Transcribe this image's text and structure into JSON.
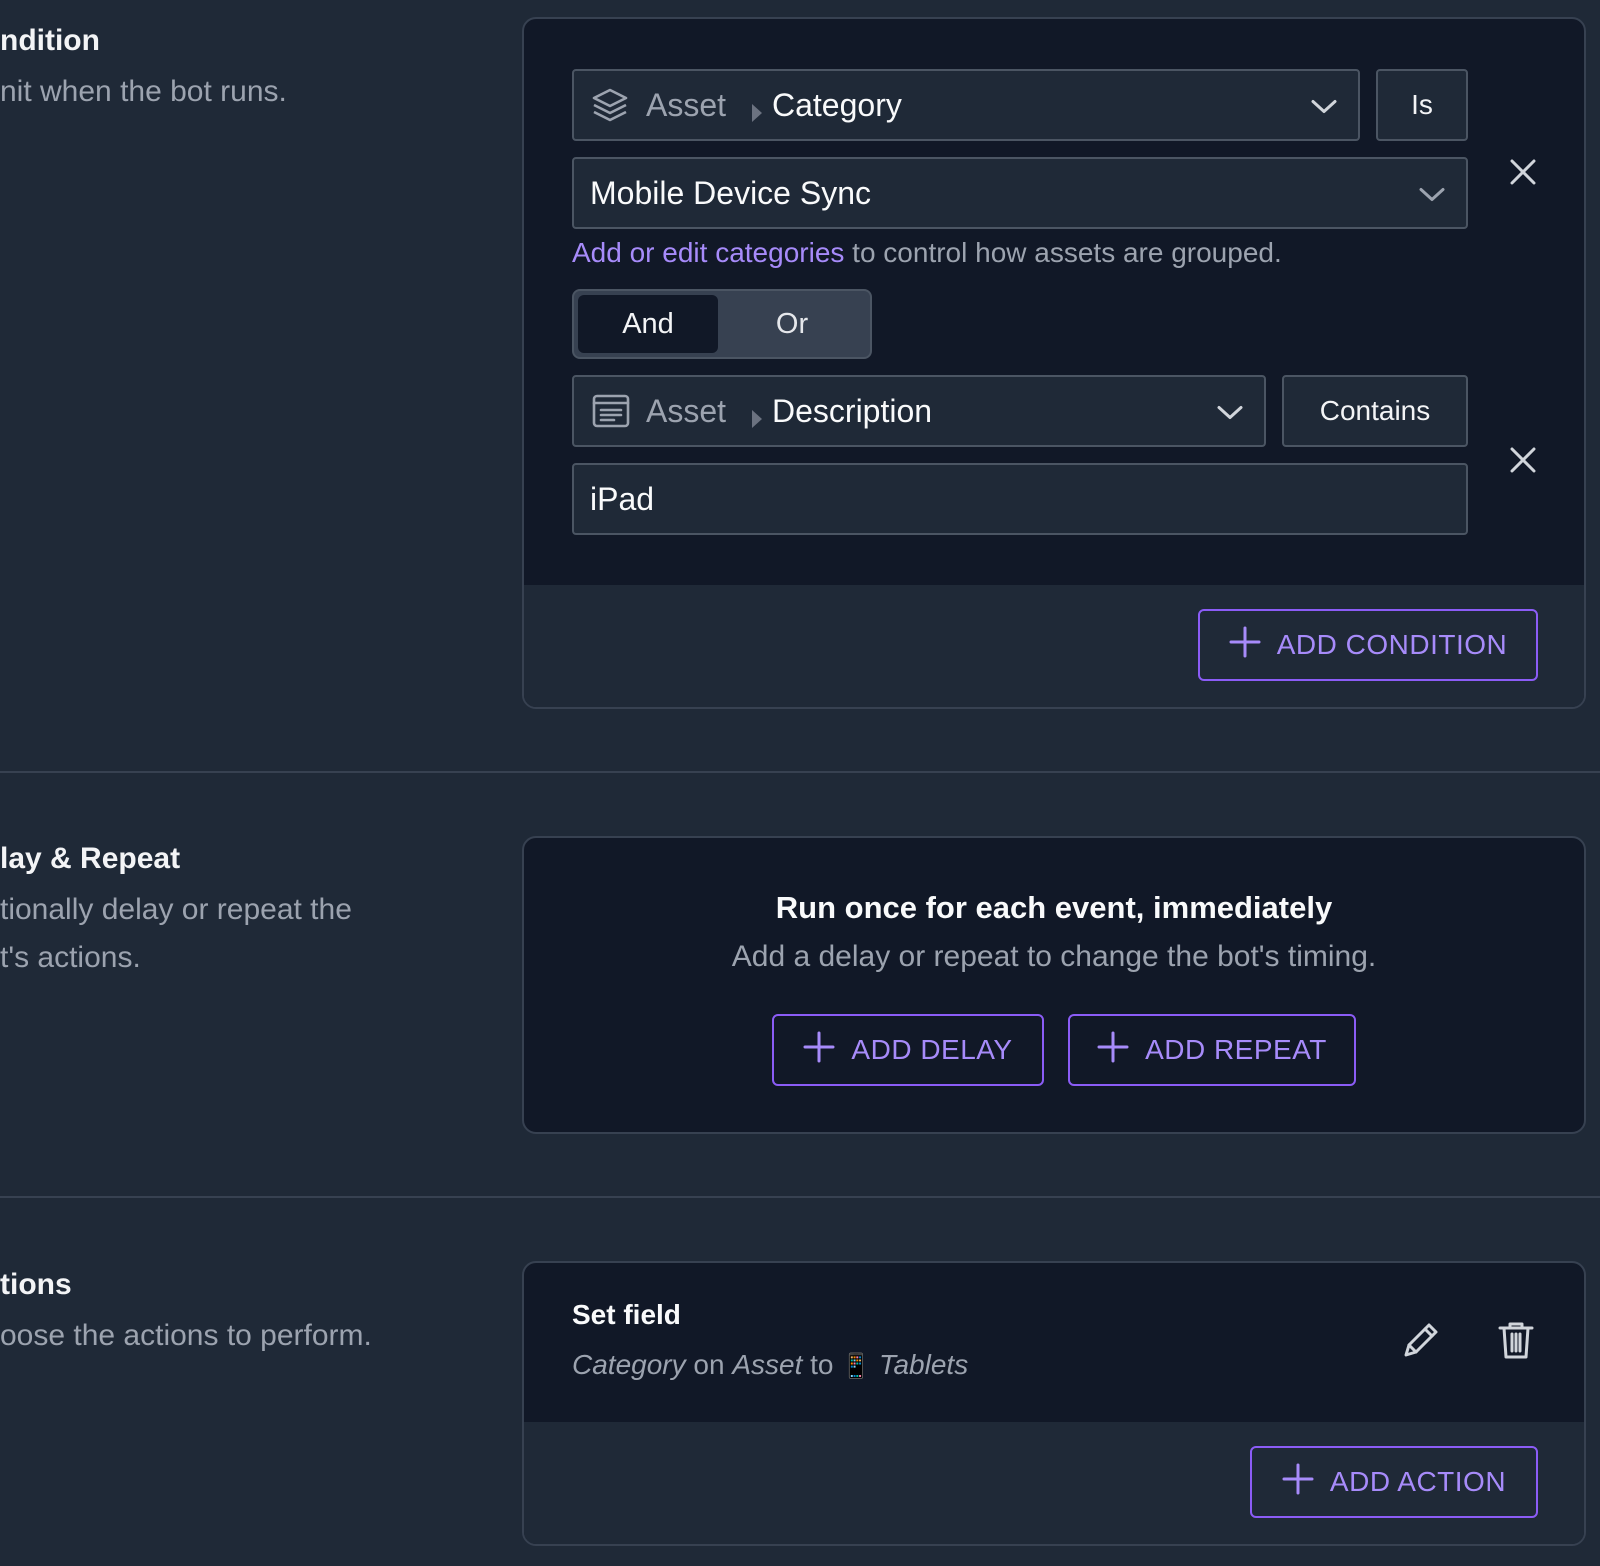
{
  "condition_section": {
    "title": "ndition",
    "desc": "nit when the bot runs."
  },
  "conditions": [
    {
      "field_prefix": "Asset",
      "field_name": "Category",
      "field_icon": "layers-icon",
      "operator": "Is",
      "value": "Mobile Device Sync"
    },
    {
      "field_prefix": "Asset",
      "field_name": "Description",
      "field_icon": "description-icon",
      "operator": "Contains",
      "value": "iPad"
    }
  ],
  "help": {
    "link": "Add or edit categories",
    "rest": " to control how assets are grouped."
  },
  "logic_toggle": {
    "and_label": "And",
    "or_label": "Or",
    "selected": "And"
  },
  "add_condition_label": "ADD CONDITION",
  "delay_section": {
    "title": "lay & Repeat",
    "desc_line1": "tionally delay or repeat the",
    "desc_line2": "t's actions."
  },
  "timing": {
    "title": "Run once for each event, immediately",
    "subtitle": "Add a delay or repeat to change the bot's timing.",
    "add_delay_label": "ADD DELAY",
    "add_repeat_label": "ADD REPEAT"
  },
  "actions_section": {
    "title": "tions",
    "desc": "oose the actions to perform."
  },
  "action": {
    "title": "Set field",
    "field": "Category",
    "on_text": " on ",
    "target": "Asset",
    "to_text": " to ",
    "emoji": "📱",
    "value": "Tablets"
  },
  "add_action_label": "ADD ACTION",
  "colors": {
    "background": "#1f2937",
    "card": "#111827",
    "accent": "#8b5cf6",
    "accent_text": "#a78bfa",
    "muted_text": "#9ca3af"
  }
}
